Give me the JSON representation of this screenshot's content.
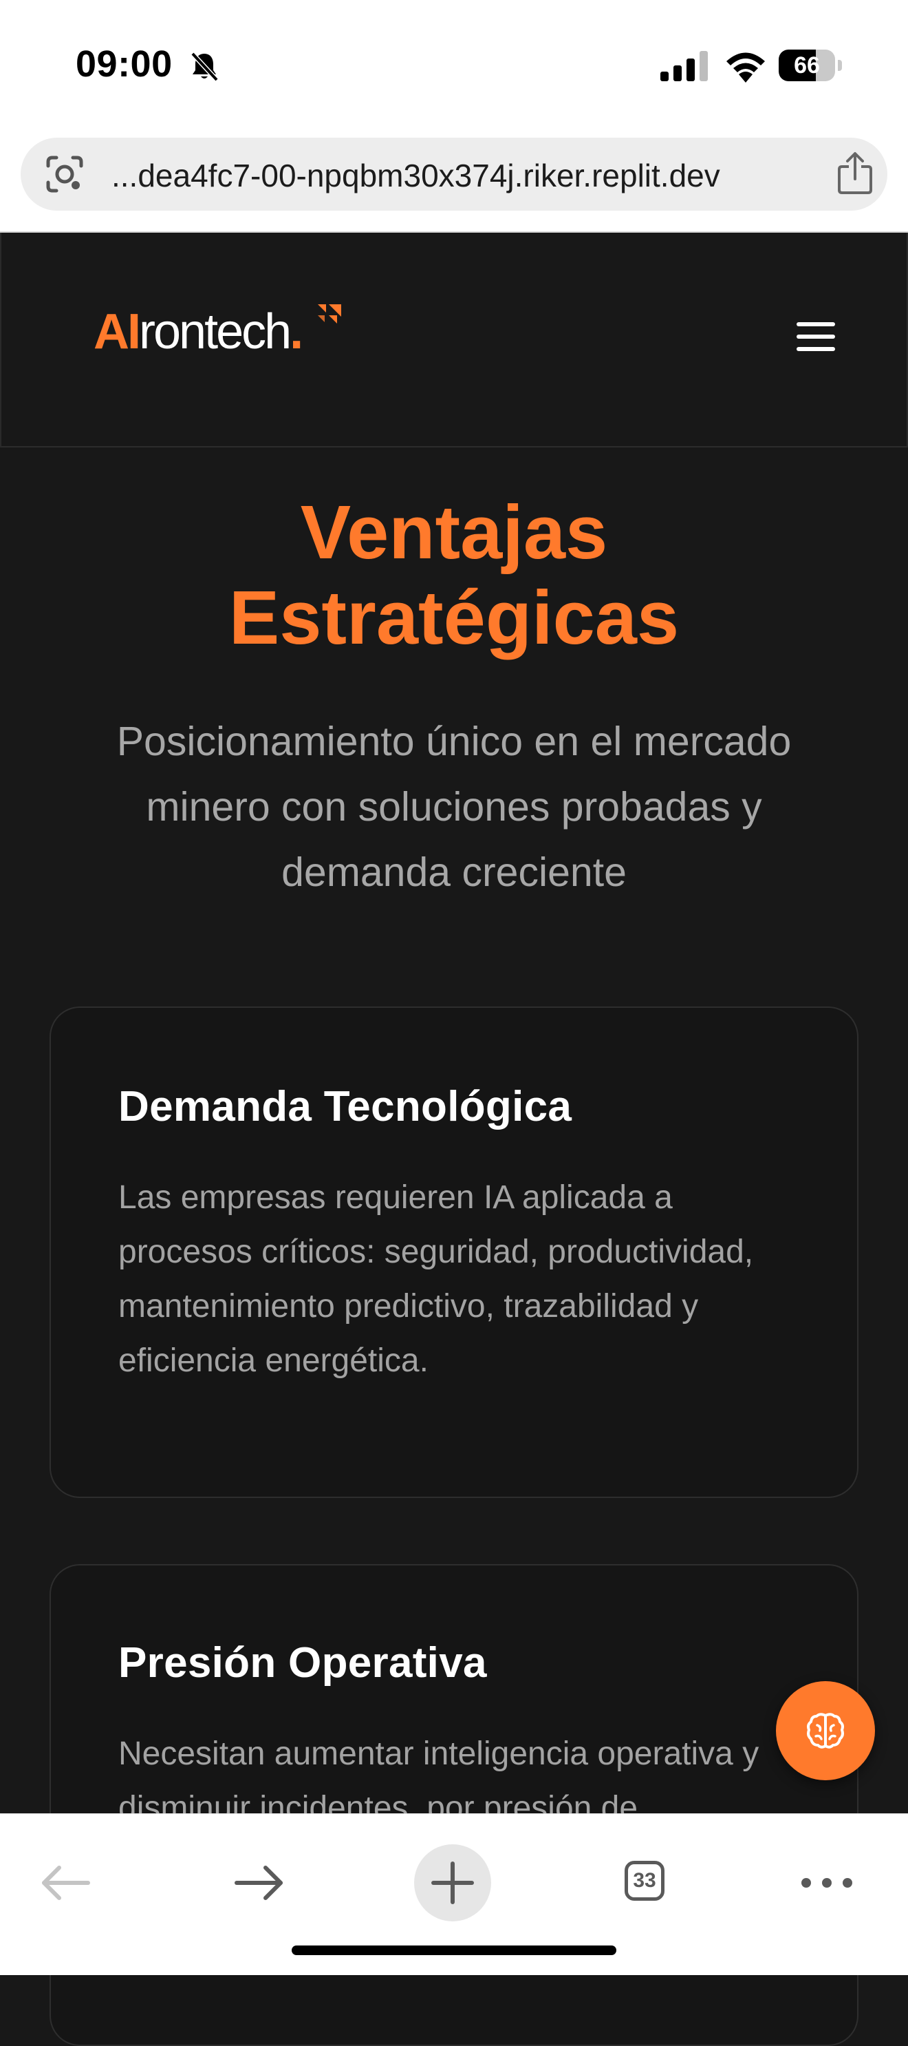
{
  "status_bar": {
    "time": "09:00",
    "battery_level": "66",
    "battery_fraction": 0.66,
    "icons": [
      "bell-slash-icon",
      "cellular-signal-icon",
      "wifi-icon",
      "battery-icon"
    ]
  },
  "browser": {
    "url": "...dea4fc7-00-npqbm30x374j.riker.replit.dev",
    "icons": [
      "lens-icon",
      "share-icon"
    ]
  },
  "site_header": {
    "logo_ai": "AI",
    "logo_rest": "rontech",
    "logo_dot": ".",
    "menu_icon": "hamburger-menu-icon"
  },
  "hero": {
    "title_line1": "Ventajas",
    "title_line2": "Estratégicas",
    "subtitle": "Posicionamiento único en el mercado minero con soluciones probadas y demanda creciente"
  },
  "cards": [
    {
      "title": "Demanda Tecnológica",
      "body": "Las empresas requieren IA aplicada a procesos críticos: seguridad, productividad, mantenimiento predictivo, trazabilidad y eficiencia energética."
    },
    {
      "title": "Presión Operativa",
      "body": "Necesitan aumentar inteligencia operativa y disminuir incidentes, por presión de"
    }
  ],
  "fab": {
    "icon": "brain-icon"
  },
  "toolbar": {
    "tab_count": "33",
    "icons": [
      "back-arrow-icon",
      "forward-arrow-icon",
      "plus-icon",
      "tabs-icon",
      "more-icon"
    ]
  },
  "colors": {
    "accent": "#ff7a2c",
    "page_bg": "#181818",
    "card_bg": "#151515",
    "card_border": "#2e2e2e",
    "body_text": "#a3a3a3"
  }
}
